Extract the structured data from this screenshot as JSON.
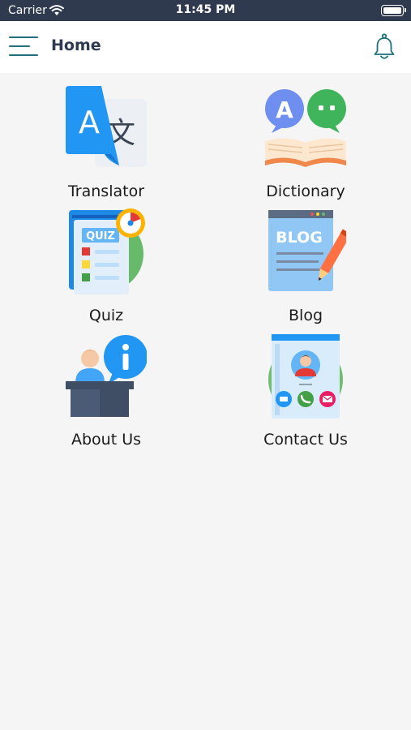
{
  "status_bar": {
    "carrier": "Carrier",
    "time": "11:45 PM"
  },
  "header": {
    "title": "Home",
    "menu_icon": "hamburger-menu-icon",
    "notification_icon": "bell-icon"
  },
  "tiles": [
    {
      "label": "Translator",
      "icon": "translator-icon"
    },
    {
      "label": "Dictionary",
      "icon": "dictionary-icon"
    },
    {
      "label": "Quiz",
      "icon": "quiz-icon",
      "icon_text": "QUIZ"
    },
    {
      "label": "Blog",
      "icon": "blog-icon",
      "icon_text": "BLOG"
    },
    {
      "label": "About Us",
      "icon": "about-us-icon"
    },
    {
      "label": "Contact Us",
      "icon": "contact-us-icon"
    }
  ],
  "colors": {
    "status_bar": "#2f3a4f",
    "header_bg": "#ffffff",
    "page_bg": "#f5f5f5",
    "accent": "#1e6f7a"
  }
}
